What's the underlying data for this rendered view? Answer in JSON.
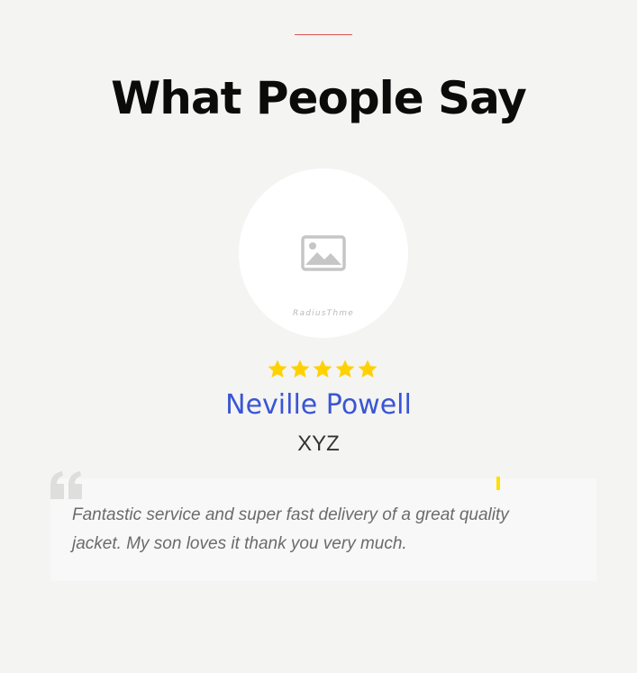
{
  "section": {
    "title": "What People Say"
  },
  "testimonial": {
    "avatar_watermark": "RadiusThme",
    "rating": 5,
    "rating_max": 5,
    "name": "Neville Powell",
    "role": "XYZ",
    "quote": "Fantastic service and super fast delivery of a great quality jacket. My son loves it thank you very much."
  },
  "colors": {
    "background": "#f4f4f2",
    "accent_line": "#d9534f",
    "name": "#3a55d4",
    "star": "#ffd100",
    "tick": "#ffde00"
  },
  "icons": {
    "avatar_placeholder": "image-placeholder-icon",
    "star": "star-icon",
    "quote": "quote-icon"
  }
}
